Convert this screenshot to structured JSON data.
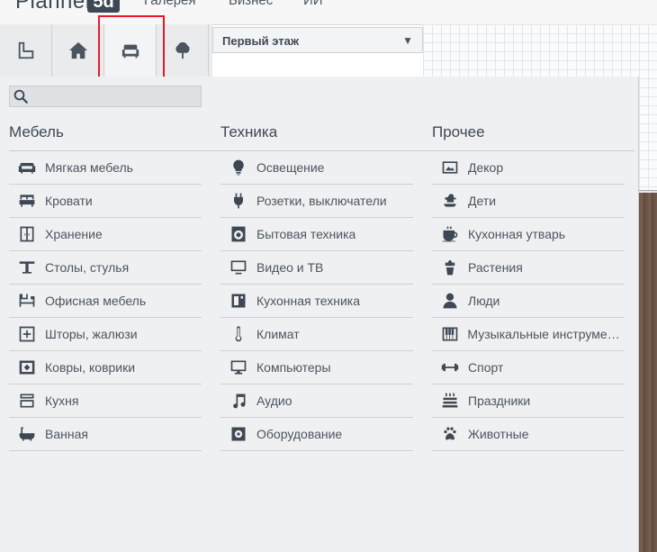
{
  "app": {
    "logo_text": "Planner",
    "logo_badge": "5d",
    "nav": [
      "Галерея",
      "Бизнес",
      "ИИ"
    ]
  },
  "tabs": [
    {
      "name": "floorplan",
      "icon": "floorplan-icon"
    },
    {
      "name": "structure",
      "icon": "home-icon"
    },
    {
      "name": "furniture",
      "icon": "armchair-icon",
      "active": true
    },
    {
      "name": "exterior",
      "icon": "tree-icon"
    }
  ],
  "floor_select": {
    "value": "Первый этаж"
  },
  "search": {
    "placeholder": "",
    "value": ""
  },
  "columns": [
    {
      "title": "Мебель",
      "items": [
        {
          "label": "Мягкая мебель",
          "icon": "sofa-icon"
        },
        {
          "label": "Кровати",
          "icon": "bed-icon"
        },
        {
          "label": "Хранение",
          "icon": "wardrobe-icon"
        },
        {
          "label": "Столы, стулья",
          "icon": "table-icon"
        },
        {
          "label": "Офисная мебель",
          "icon": "desk-icon"
        },
        {
          "label": "Шторы, жалюзи",
          "icon": "curtain-icon"
        },
        {
          "label": "Ковры, коврики",
          "icon": "rug-icon"
        },
        {
          "label": "Кухня",
          "icon": "kitchen-icon"
        },
        {
          "label": "Ванная",
          "icon": "bathtub-icon"
        }
      ]
    },
    {
      "title": "Техника",
      "items": [
        {
          "label": "Освещение",
          "icon": "bulb-icon"
        },
        {
          "label": "Розетки, выключатели",
          "icon": "plug-icon"
        },
        {
          "label": "Бытовая техника",
          "icon": "washer-icon"
        },
        {
          "label": "Видео и ТВ",
          "icon": "tv-icon"
        },
        {
          "label": "Кухонная техника",
          "icon": "appliance-icon"
        },
        {
          "label": "Климат",
          "icon": "thermometer-icon"
        },
        {
          "label": "Компьютеры",
          "icon": "monitor-icon"
        },
        {
          "label": "Аудио",
          "icon": "music-note-icon"
        },
        {
          "label": "Оборудование",
          "icon": "gear-icon"
        }
      ]
    },
    {
      "title": "Прочее",
      "items": [
        {
          "label": "Декор",
          "icon": "picture-icon"
        },
        {
          "label": "Дети",
          "icon": "rocking-horse-icon"
        },
        {
          "label": "Кухонная утварь",
          "icon": "cup-icon"
        },
        {
          "label": "Растения",
          "icon": "plant-icon"
        },
        {
          "label": "Люди",
          "icon": "person-icon"
        },
        {
          "label": "Музыкальные инструменты",
          "icon": "piano-icon"
        },
        {
          "label": "Спорт",
          "icon": "dumbbell-icon"
        },
        {
          "label": "Праздники",
          "icon": "cake-icon"
        },
        {
          "label": "Животные",
          "icon": "paw-icon"
        }
      ]
    }
  ]
}
